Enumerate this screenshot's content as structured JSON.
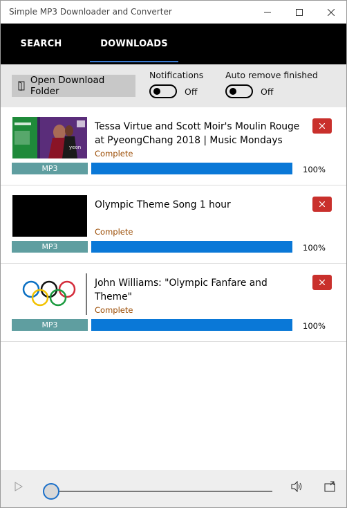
{
  "window": {
    "title": "Simple MP3 Downloader and Converter"
  },
  "nav": {
    "tabs": [
      {
        "label": "SEARCH",
        "active": false
      },
      {
        "label": "DOWNLOADS",
        "active": true
      }
    ]
  },
  "toolbar": {
    "open_folder_label": "Open Download Folder",
    "notifications": {
      "label": "Notifications",
      "state": "Off"
    },
    "auto_remove": {
      "label": "Auto remove finished",
      "state": "Off"
    }
  },
  "downloads": [
    {
      "title": "Tessa Virtue and Scott Moir's Moulin Rouge at PyeongChang 2018 | Music Mondays",
      "status": "Complete",
      "format": "MP3",
      "progress": 100,
      "progress_text": "100%",
      "thumbnail": "figure-skating-thumbnail"
    },
    {
      "title": "Olympic Theme Song 1 hour",
      "status": "Complete",
      "format": "MP3",
      "progress": 100,
      "progress_text": "100%",
      "thumbnail": "black-thumbnail"
    },
    {
      "title": "John Williams: \"Olympic Fanfare and Theme\"",
      "status": "Complete",
      "format": "MP3",
      "progress": 100,
      "progress_text": "100%",
      "thumbnail": "olympic-rings-thumbnail"
    }
  ],
  "player": {
    "position": 0
  },
  "colors": {
    "nav_bg": "#000000",
    "tab_underline": "#3a7ad1",
    "progress_fill": "#0a78d7",
    "badge_bg": "#5f9ea0",
    "status_text": "#9a4a00",
    "remove_button": "#c9302c"
  }
}
